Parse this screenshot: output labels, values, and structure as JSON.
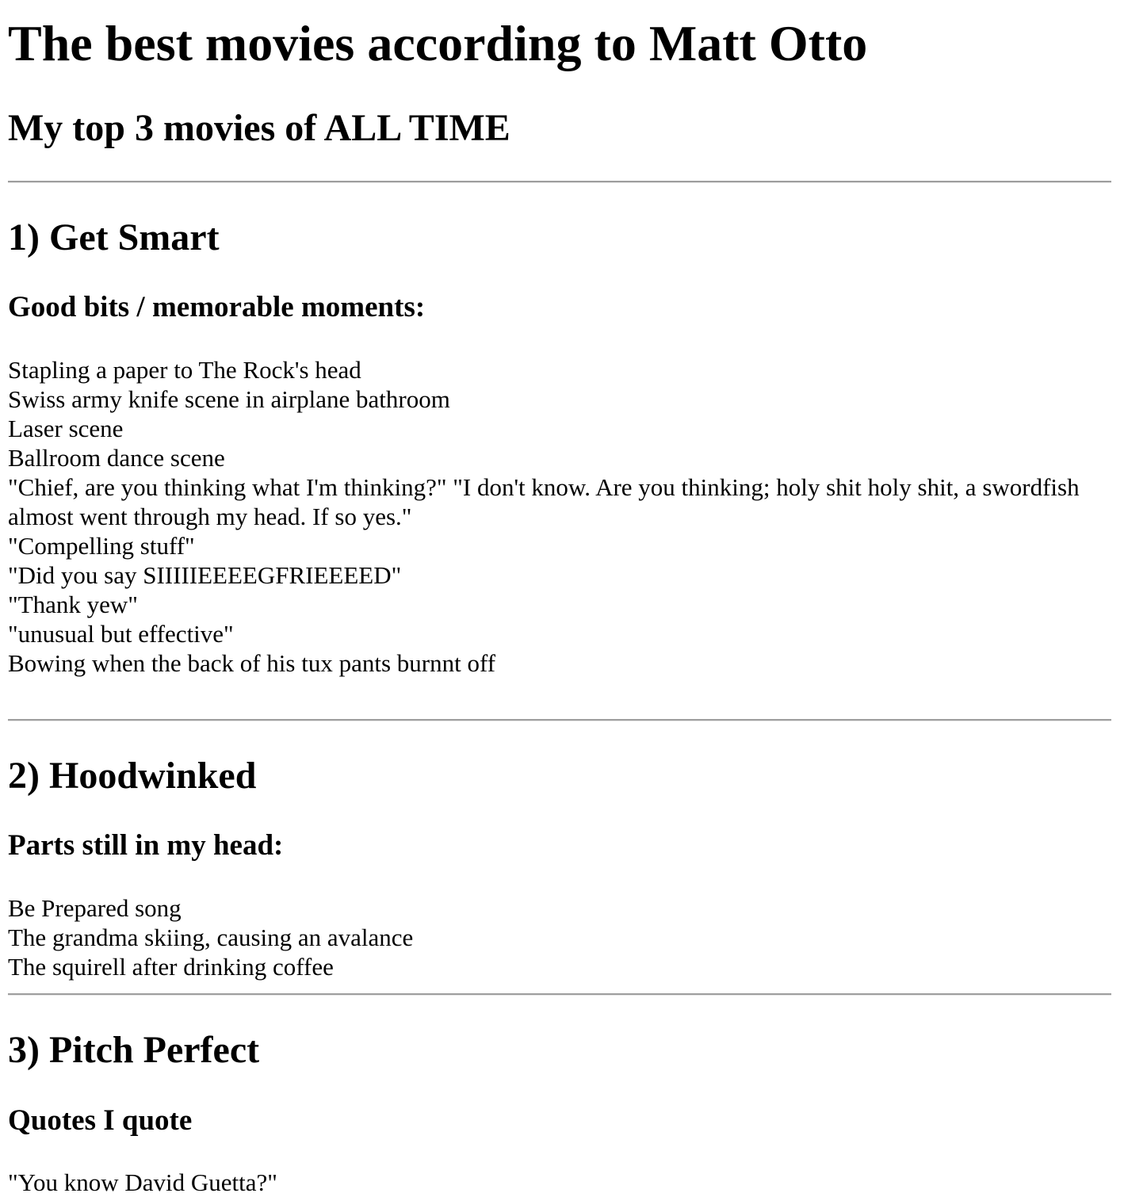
{
  "page": {
    "title": "The best movies according to Matt Otto",
    "subtitle": "My top 3 movies of ALL TIME"
  },
  "movies": [
    {
      "heading": "1) Get Smart",
      "section_label": "Good bits / memorable moments:",
      "items": [
        "Stapling a paper to The Rock's head",
        "Swiss army knife scene in airplane bathroom",
        "Laser scene",
        "Ballroom dance scene",
        "\"Chief, are you thinking what I'm thinking?\" \"I don't know. Are you thinking; holy shit holy shit, a swordfish almost went through my head. If so yes.\"",
        "\"Compelling stuff\"",
        "\"Did you say SIIIIIEEEEGFRIEEEED\"",
        "\"Thank yew\"",
        "\"unusual but effective\"",
        "Bowing when the back of his tux pants burnnt off"
      ]
    },
    {
      "heading": "2) Hoodwinked",
      "section_label": "Parts still in my head:",
      "items": [
        "Be Prepared song",
        "The grandma skiing, causing an avalance",
        "The squirell after drinking coffee"
      ]
    },
    {
      "heading": "3) Pitch Perfect",
      "section_label": "Quotes I quote",
      "items": [
        "\"You know David Guetta?\""
      ]
    }
  ]
}
